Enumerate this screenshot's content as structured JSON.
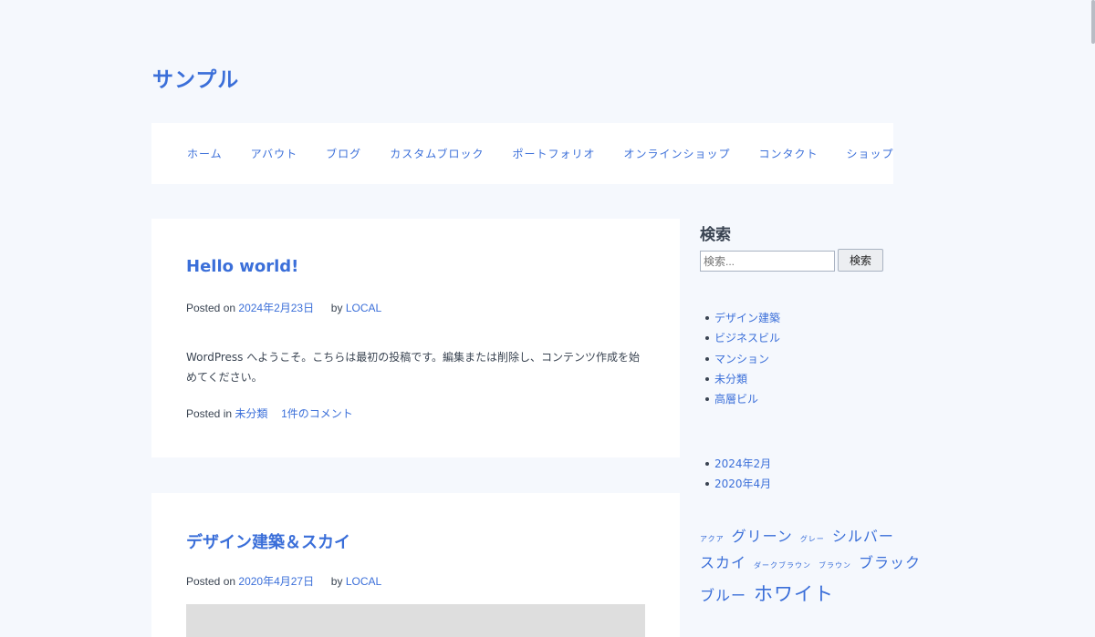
{
  "site": {
    "title": "サンプル"
  },
  "nav": {
    "items": [
      "ホーム",
      "アバウト",
      "ブログ",
      "カスタムブロック",
      "ポートフォリオ",
      "オンラインショップ",
      "コンタクト",
      "ショップ"
    ]
  },
  "posts": [
    {
      "title": "Hello world!",
      "posted_on_label": "Posted on",
      "date": "2024年2月23日",
      "by_label": "by",
      "author": "LOCAL",
      "excerpt": "WordPress へようこそ。こちらは最初の投稿です。編集または削除し、コンテンツ作成を始めてください。",
      "posted_in_label": "Posted in",
      "category": "未分類",
      "comments": "1件のコメント"
    },
    {
      "title": "デザイン建築＆スカイ",
      "posted_on_label": "Posted on",
      "date": "2020年4月27日",
      "by_label": "by",
      "author": "LOCAL"
    }
  ],
  "sidebar": {
    "search": {
      "title": "検索",
      "placeholder": "検索...",
      "button_label": "検索"
    },
    "categories": [
      "デザイン建築",
      "ビジネスビル",
      "マンション",
      "未分類",
      "高層ビル"
    ],
    "archives": [
      "2024年2月",
      "2020年4月"
    ],
    "tags": [
      {
        "label": "アクア"
      },
      {
        "label": "グリーン"
      },
      {
        "label": "グレー"
      },
      {
        "label": "シルバー"
      },
      {
        "label": "スカイ"
      },
      {
        "label": "ダークブラウン"
      },
      {
        "label": "ブラウン"
      },
      {
        "label": "ブラック"
      },
      {
        "label": "ブルー"
      },
      {
        "label": "ホワイト"
      }
    ]
  },
  "colors": {
    "accent": "#3b6fd9",
    "background": "#f5f8fd",
    "card": "#ffffff",
    "text": "#3a4452"
  }
}
